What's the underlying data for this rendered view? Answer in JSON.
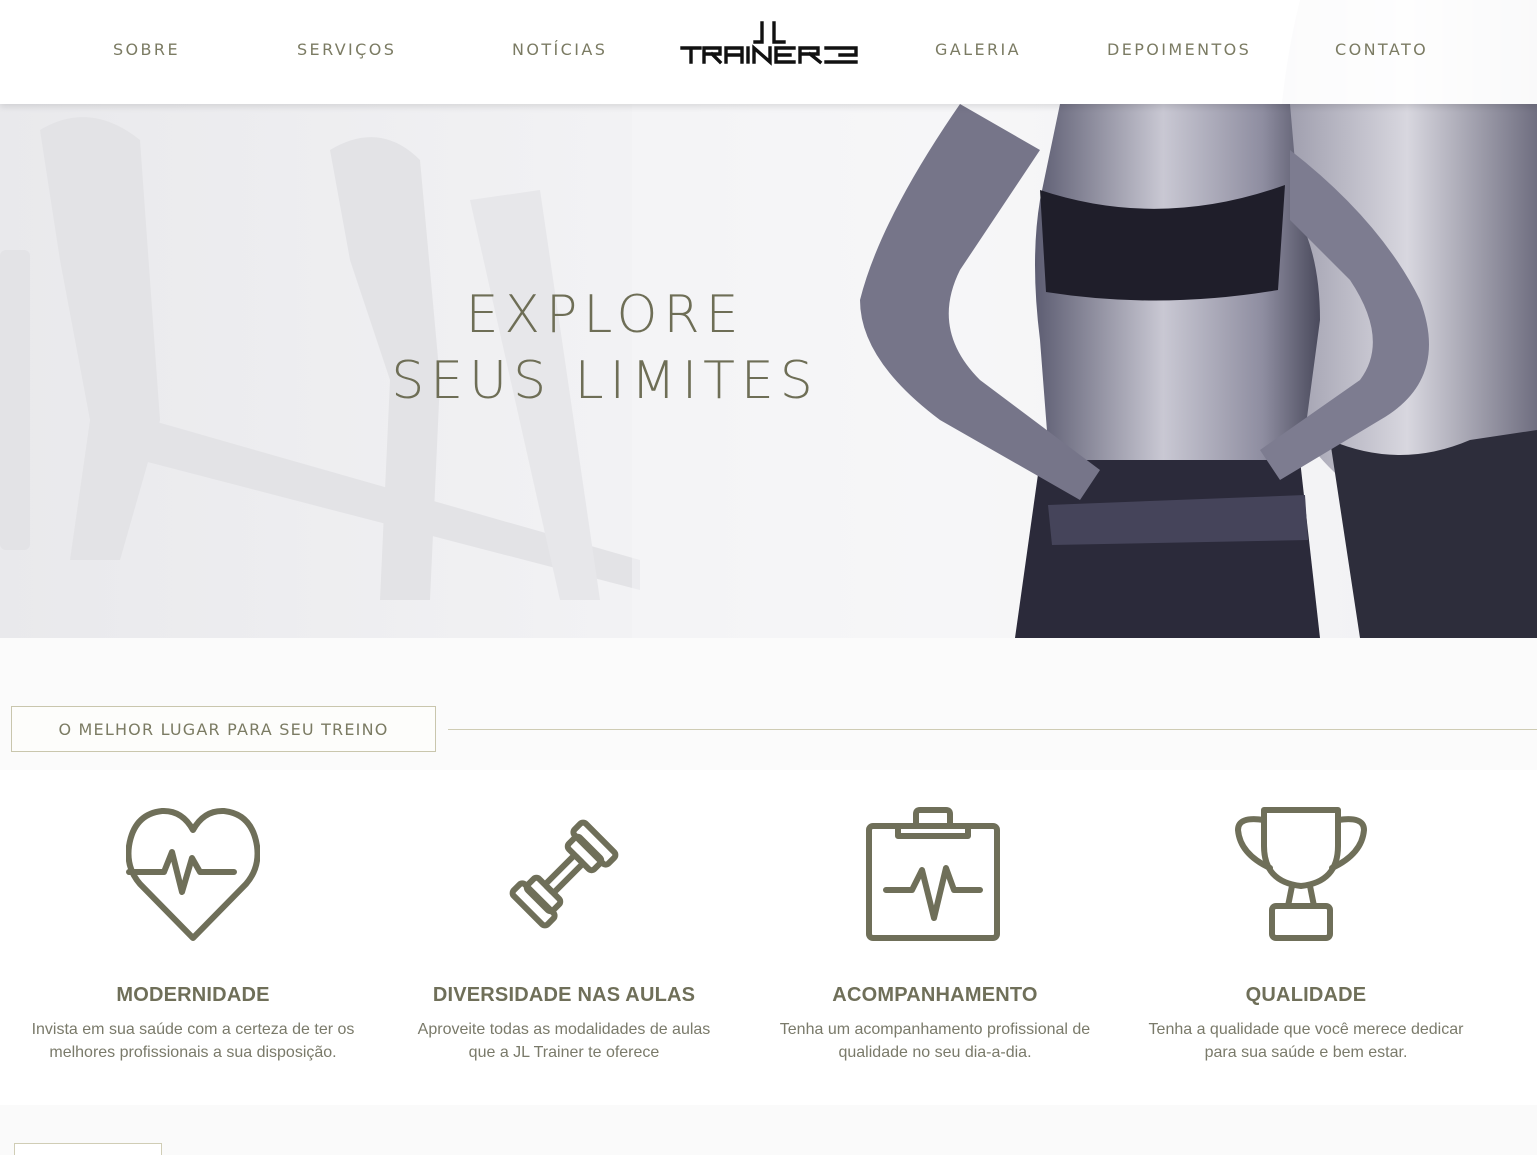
{
  "nav": {
    "left": [
      "SOBRE",
      "SERVIÇOS",
      "NOTÍCIAS"
    ],
    "right": [
      "GALERIA",
      "DEPOIMENTOS",
      "CONTATO"
    ],
    "logo_text_top": "JL",
    "logo_text_bottom": "TRAINER"
  },
  "hero": {
    "line1": "EXPLORE",
    "line2": "SEUS LIMITES"
  },
  "section": {
    "label": "O MELHOR LUGAR PARA SEU TREINO"
  },
  "features": [
    {
      "icon": "heart-pulse-icon",
      "title": "MODERNIDADE",
      "line1": "Invista em sua saúde com a certeza de ter os",
      "line2": "melhores profissionais a sua disposição."
    },
    {
      "icon": "dumbbell-icon",
      "title": "DIVERSIDADE NAS AULAS",
      "line1": "Aproveite todas as modalidades de aulas",
      "line2": "que a JL Trainer te oferece"
    },
    {
      "icon": "clipboard-pulse-icon",
      "title": "ACOMPANHAMENTO",
      "line1": "Tenha um acompanhamento profissional de",
      "line2": "qualidade no seu dia-a-dia."
    },
    {
      "icon": "trophy-icon",
      "title": "QUALIDADE",
      "line1": "Tenha a qualidade que você merece dedicar",
      "line2": "para sua saúde e bem estar."
    }
  ],
  "colors": {
    "accent": "#6f6f59",
    "nav_text": "#7b7b63",
    "body_text": "#7a7a6a"
  }
}
